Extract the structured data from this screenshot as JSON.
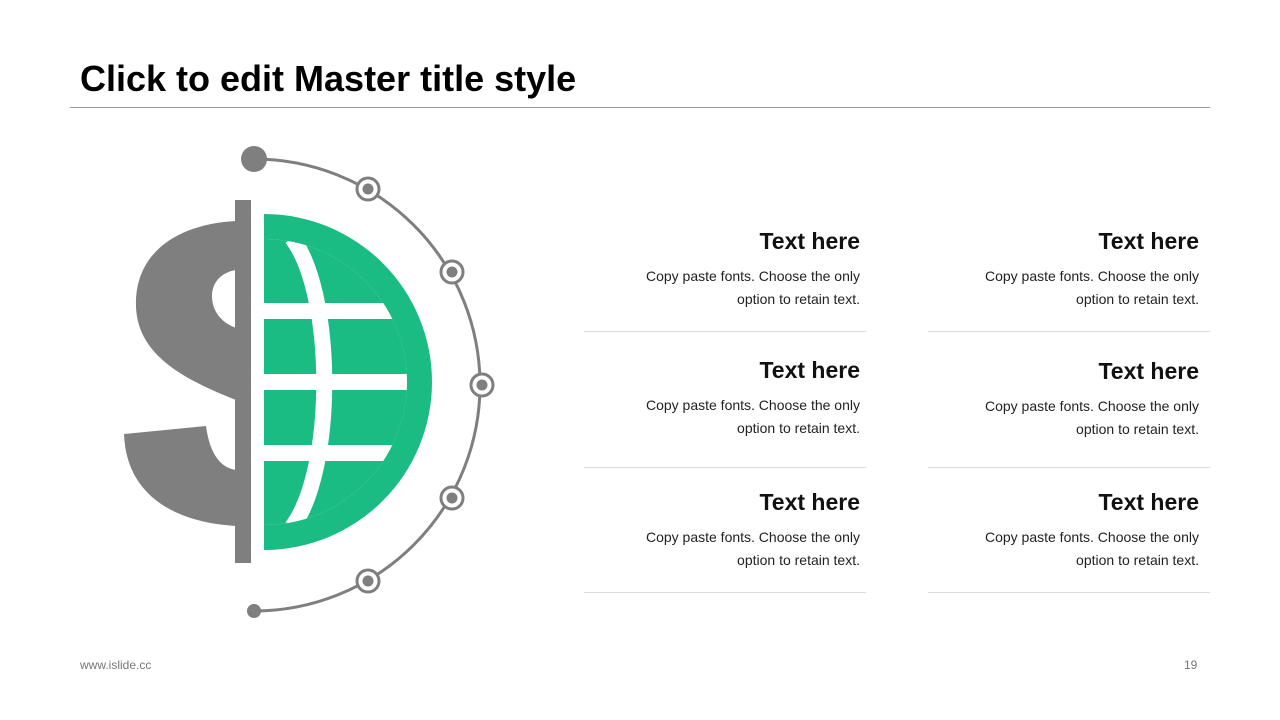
{
  "slide": {
    "title": "Click to edit Master title style"
  },
  "graphic": {
    "icon": "dollar-globe-icon",
    "colors": {
      "accent": "#1ABC84",
      "gray": "#7F7F7F"
    }
  },
  "items": [
    {
      "heading": "Text here",
      "body_line1": "Copy paste fonts. Choose the only",
      "body_line2": "option to retain text."
    },
    {
      "heading": "Text here",
      "body_line1": "Copy paste fonts. Choose the only",
      "body_line2": "option to retain text."
    },
    {
      "heading": "Text here",
      "body_line1": "Copy paste fonts. Choose the only",
      "body_line2": "option to retain text."
    },
    {
      "heading": "Text here",
      "body_line1": "Copy paste fonts. Choose the only",
      "body_line2": "option to retain text."
    },
    {
      "heading": "Text here",
      "body_line1": "Copy paste fonts. Choose the only",
      "body_line2": "option to retain text."
    },
    {
      "heading": "Text here",
      "body_line1": "Copy paste fonts. Choose the only",
      "body_line2": "option to retain text."
    }
  ],
  "footer": {
    "url": "www.islide.cc",
    "page_number": "19"
  }
}
